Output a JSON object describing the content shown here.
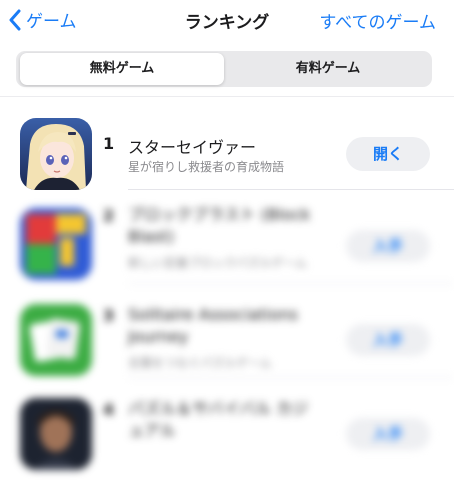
{
  "nav": {
    "back_label": "ゲーム",
    "title": "ランキング",
    "right_label": "すべてのゲーム"
  },
  "segment": {
    "options": [
      "無料ゲーム",
      "有料ゲーム"
    ],
    "selected": "無料ゲーム"
  },
  "apps": [
    {
      "rank": "1",
      "name": "スターセイヴァー",
      "subtitle": "星が宿りし救援者の育成物語",
      "button": "開く",
      "icon": "anime-girl-icon"
    },
    {
      "rank": "2",
      "name": "ブロックブラスト (Block Blast)",
      "subtitle": "新しい定番ブロックパズルゲーム",
      "button": "入手",
      "icon": "block-puzzle-icon"
    },
    {
      "rank": "3",
      "name": "Solitaire Associations Journey",
      "subtitle": "言葉をつなぐパズルゲーム",
      "button": "入手",
      "icon": "solitaire-cards-icon"
    },
    {
      "rank": "4",
      "name": "パズル＆サバイバル カジュアル",
      "subtitle": "",
      "button": "入手",
      "icon": "portrait-game-icon"
    }
  ],
  "colors": {
    "accent": "#1a7cf6",
    "secondary_text": "#8a8a8e",
    "button_bg": "#eeeff2"
  }
}
